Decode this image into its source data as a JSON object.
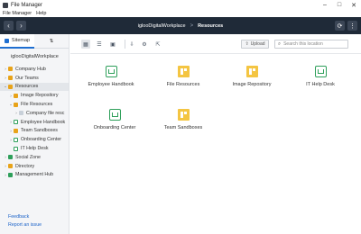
{
  "window": {
    "title": "File Manager",
    "controls": [
      "–",
      "□",
      "✕"
    ]
  },
  "menu": [
    "File Manager",
    "Help"
  ],
  "nav": {
    "back_glyph": "‹",
    "forward_glyph": "›",
    "breadcrumb": [
      "iglooDigitalWorkplace",
      "Resources"
    ],
    "separator": ">",
    "refresh_glyph": "⟳",
    "more_glyph": "⋮"
  },
  "sidebar": {
    "tabs": [
      {
        "label": "Sitemap",
        "icon": "sitemap-icon"
      },
      {
        "label": "⇅",
        "icon": "sort-icon"
      }
    ],
    "root": "iglooDigitalWorkplace",
    "items": [
      {
        "label": "Company Hub",
        "icon": "folder",
        "depth": 0,
        "caret": "›"
      },
      {
        "label": "Our Teams",
        "icon": "folder",
        "depth": 0,
        "caret": "›"
      },
      {
        "label": "Resources",
        "icon": "folder",
        "depth": 0,
        "caret": "⌄",
        "selected": true
      },
      {
        "label": "Image Repository",
        "icon": "grid",
        "depth": 1,
        "caret": "›"
      },
      {
        "label": "File Resources",
        "icon": "grid",
        "depth": 1,
        "caret": "⌄"
      },
      {
        "label": "Company file resc",
        "icon": "file",
        "depth": 2,
        "caret": "›"
      },
      {
        "label": "Employee Handbook",
        "icon": "home",
        "depth": 1,
        "caret": "›"
      },
      {
        "label": "Team Sandboxes",
        "icon": "grid",
        "depth": 1,
        "caret": "›"
      },
      {
        "label": "Onboarding Center",
        "icon": "home",
        "depth": 1,
        "caret": "›"
      },
      {
        "label": "IT Help Desk",
        "icon": "home",
        "depth": 1,
        "caret": ""
      },
      {
        "label": "Social Zone",
        "icon": "green",
        "depth": 0,
        "caret": "›"
      },
      {
        "label": "Directory",
        "icon": "folder",
        "depth": 0,
        "caret": "›"
      },
      {
        "label": "Management Hub",
        "icon": "green",
        "depth": 0,
        "caret": "›"
      }
    ],
    "links": [
      "Feedback",
      "Report an issue"
    ]
  },
  "toolbar": {
    "view_buttons": [
      {
        "name": "grid-view-icon",
        "glyph": "▦",
        "active": true
      },
      {
        "name": "list-view-icon",
        "glyph": "☰",
        "active": false
      },
      {
        "name": "folder-view-icon",
        "glyph": "▣",
        "active": false
      },
      {
        "name": "download-icon",
        "glyph": "⇩",
        "active": false
      },
      {
        "name": "settings-icon",
        "glyph": "⚙",
        "active": false
      },
      {
        "name": "external-link-icon",
        "glyph": "⇱",
        "active": false
      }
    ],
    "upload_label": "Upload",
    "upload_glyph": "⇧",
    "search_placeholder": "Search this location"
  },
  "tiles": [
    {
      "label": "Employee Handbook",
      "icon": "home"
    },
    {
      "label": "File Resources",
      "icon": "grid"
    },
    {
      "label": "Image Repository",
      "icon": "grid"
    },
    {
      "label": "IT Help Desk",
      "icon": "home"
    },
    {
      "label": "Onboarding Center",
      "icon": "home"
    },
    {
      "label": "Team Sandboxes",
      "icon": "grid"
    }
  ],
  "colors": {
    "navbar": "#1f2a38",
    "accent": "#1f6fd1",
    "folder": "#e8a319",
    "space": "#2e9f5a",
    "link": "#1a62c8"
  }
}
